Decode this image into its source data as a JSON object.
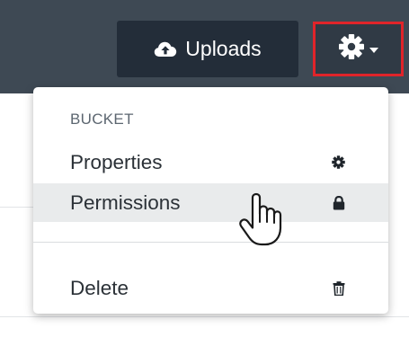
{
  "toolbar": {
    "uploads_label": "Uploads",
    "uploads_icon": "cloud-upload-icon",
    "settings_icon": "gear-icon",
    "settings_highlight_color": "#e0242a"
  },
  "menu": {
    "header": "BUCKET",
    "items": [
      {
        "label": "Properties",
        "icon": "gear-icon",
        "hover": false
      },
      {
        "label": "Permissions",
        "icon": "lock-icon",
        "hover": true
      },
      {
        "label": "Delete",
        "icon": "trash-icon",
        "hover": false
      }
    ]
  },
  "colors": {
    "topbar": "#3e4954",
    "button_dark": "#232d39",
    "menu_hover": "#e9ebec"
  },
  "cursor": "hand-pointer-icon"
}
